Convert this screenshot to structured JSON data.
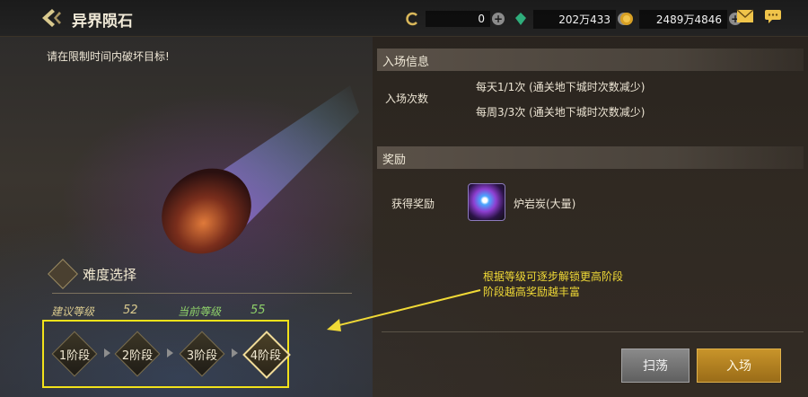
{
  "header": {
    "title": "异界陨石",
    "back_icon": "back-arrow-icon",
    "resources": [
      {
        "name": "coin-c-icon",
        "value": "0",
        "color": "#d9b75a"
      },
      {
        "name": "crystal-icon",
        "value": "202万433",
        "color": "#2fae7c"
      },
      {
        "name": "gold-icon",
        "value": "2489万4846",
        "color": "#d8a024"
      }
    ],
    "mail_icon": "mail-icon",
    "chat_icon": "chat-icon"
  },
  "left": {
    "objective": "请在限制时间内破坏目标!",
    "difficulty_title": "难度选择",
    "recommend_label": "建议等级",
    "recommend_value": "52",
    "current_label": "当前等级",
    "current_value": "55",
    "stages": [
      "1阶段",
      "2阶段",
      "3阶段",
      "4阶段"
    ],
    "selected_stage": "4阶段"
  },
  "entry": {
    "header": "入场信息",
    "label": "入场次数",
    "daily": "每天1/1次 (通关地下城时次数减少)",
    "weekly": "每周3/3次 (通关地下城时次数减少)"
  },
  "reward": {
    "header": "奖励",
    "label": "获得奖励",
    "item": "炉岩炭(大量)"
  },
  "annotation": {
    "line1": "根据等级可逐步解锁更高阶段",
    "line2": "阶段越高奖励越丰富",
    "color": "#f0d936"
  },
  "buttons": {
    "sweep": "扫荡",
    "enter": "入场"
  }
}
